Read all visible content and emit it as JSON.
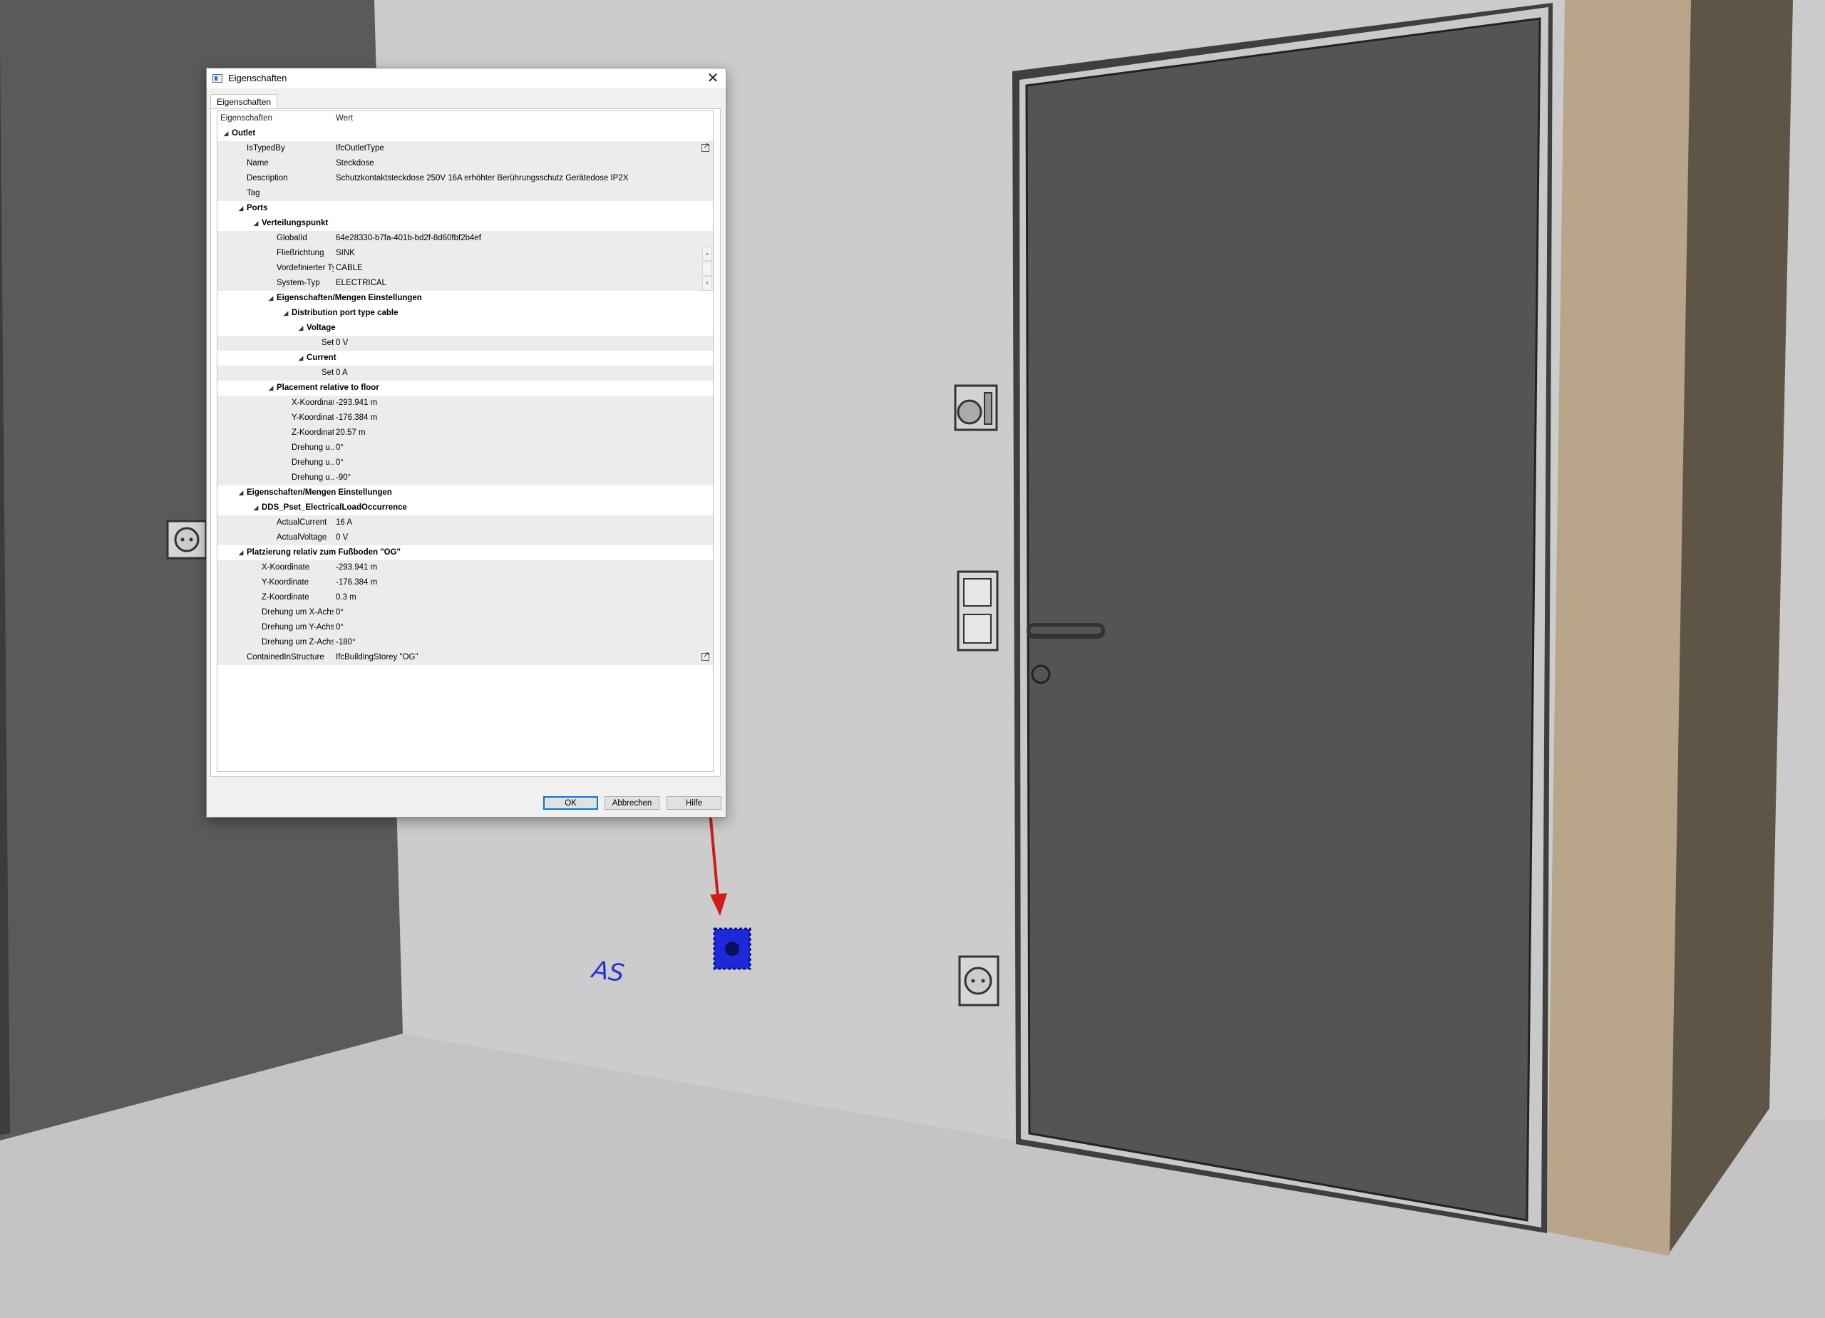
{
  "dialog": {
    "title": "Eigenschaften",
    "close_glyph": "✕",
    "tab_label": "Eigenschaften",
    "col_name": "Eigenschaften",
    "col_value": "Wert",
    "ok_label": "OK",
    "cancel_label": "Abbrechen",
    "help_label": "Hilfe"
  },
  "rows": [
    {
      "level": 0,
      "type": "group",
      "name": "Outlet",
      "value": ""
    },
    {
      "level": 1,
      "type": "prop",
      "name": "IsTypedBy",
      "value": "IfcOutletType",
      "link": true
    },
    {
      "level": 1,
      "type": "prop",
      "name": "Name",
      "value": "Steckdose"
    },
    {
      "level": 1,
      "type": "prop",
      "name": "Description",
      "value": "Schutzkontaktsteckdose 250V 16A erhöhter Berührungsschutz Gerätedose IP2X"
    },
    {
      "level": 1,
      "type": "prop",
      "name": "Tag",
      "value": ""
    },
    {
      "level": 1,
      "type": "group",
      "name": "Ports",
      "value": ""
    },
    {
      "level": 2,
      "type": "group",
      "name": "Verteilungspunkt",
      "value": ""
    },
    {
      "level": 3,
      "type": "prop",
      "name": "GlobalId",
      "value": "64e28330-b7fa-401b-bd2f-8d60fbf2b4ef"
    },
    {
      "level": 3,
      "type": "prop",
      "name": "Fließrichtung",
      "value": "SINK"
    },
    {
      "level": 3,
      "type": "prop",
      "name": "Vordefinierter Typ",
      "value": "CABLE"
    },
    {
      "level": 3,
      "type": "prop",
      "name": "System-Typ",
      "value": "ELECTRICAL"
    },
    {
      "level": 3,
      "type": "group",
      "name": "Eigenschaften/Mengen Einstellungen",
      "value": ""
    },
    {
      "level": 4,
      "type": "group",
      "name": "Distribution port type cable",
      "value": ""
    },
    {
      "level": 5,
      "type": "group",
      "name": "Voltage",
      "value": ""
    },
    {
      "level": 6,
      "type": "prop",
      "name": "Set...",
      "value": "0 V"
    },
    {
      "level": 5,
      "type": "group",
      "name": "Current",
      "value": ""
    },
    {
      "level": 6,
      "type": "prop",
      "name": "Set...",
      "value": "0 A"
    },
    {
      "level": 3,
      "type": "group",
      "name": "Placement relative to floor",
      "value": ""
    },
    {
      "level": 4,
      "type": "prop",
      "name": "X-Koordinate",
      "value": "-293.941 m"
    },
    {
      "level": 4,
      "type": "prop",
      "name": "Y-Koordinate",
      "value": "-176.384 m"
    },
    {
      "level": 4,
      "type": "prop",
      "name": "Z-Koordinate",
      "value": "20.57 m"
    },
    {
      "level": 4,
      "type": "prop",
      "name": "Drehung u...",
      "value": "0°"
    },
    {
      "level": 4,
      "type": "prop",
      "name": "Drehung u...",
      "value": "0°"
    },
    {
      "level": 4,
      "type": "prop",
      "name": "Drehung u...",
      "value": "-90°"
    },
    {
      "level": 1,
      "type": "group",
      "name": "Eigenschaften/Mengen Einstellungen",
      "value": ""
    },
    {
      "level": 2,
      "type": "group",
      "name": "DDS_Pset_ElectricalLoadOccurrence",
      "value": ""
    },
    {
      "level": 3,
      "type": "prop",
      "name": "ActualCurrent",
      "value": "16 A"
    },
    {
      "level": 3,
      "type": "prop",
      "name": "ActualVoltage",
      "value": "0 V"
    },
    {
      "level": 1,
      "type": "group",
      "name": "Platzierung relativ zum Fußboden \"OG\"",
      "value": ""
    },
    {
      "level": 2,
      "type": "prop",
      "name": "X-Koordinate",
      "value": "-293.941 m"
    },
    {
      "level": 2,
      "type": "prop",
      "name": "Y-Koordinate",
      "value": "-176.384 m"
    },
    {
      "level": 2,
      "type": "prop",
      "name": "Z-Koordinate",
      "value": "0.3 m"
    },
    {
      "level": 2,
      "type": "prop",
      "name": "Drehung um X-Achse",
      "value": "0°"
    },
    {
      "level": 2,
      "type": "prop",
      "name": "Drehung um Y-Achse",
      "value": "0°"
    },
    {
      "level": 2,
      "type": "prop",
      "name": "Drehung um Z-Achse",
      "value": "-180°"
    },
    {
      "level": 1,
      "type": "prop",
      "name": "ContainedInStructure",
      "value": "IfcBuildingStorey \"OG\"",
      "link": true
    }
  ],
  "scene": {
    "annotation_text": "AS",
    "colors": {
      "wall_left": "#5b5b5b",
      "wall_back": "#cbcbcb",
      "floor": "#c3c3c3",
      "door": "#555555",
      "frame_wood": "#b8a58a",
      "wall_right": "#5f5547",
      "highlight": "#1e28d8",
      "arrow": "#d11a1a"
    }
  }
}
